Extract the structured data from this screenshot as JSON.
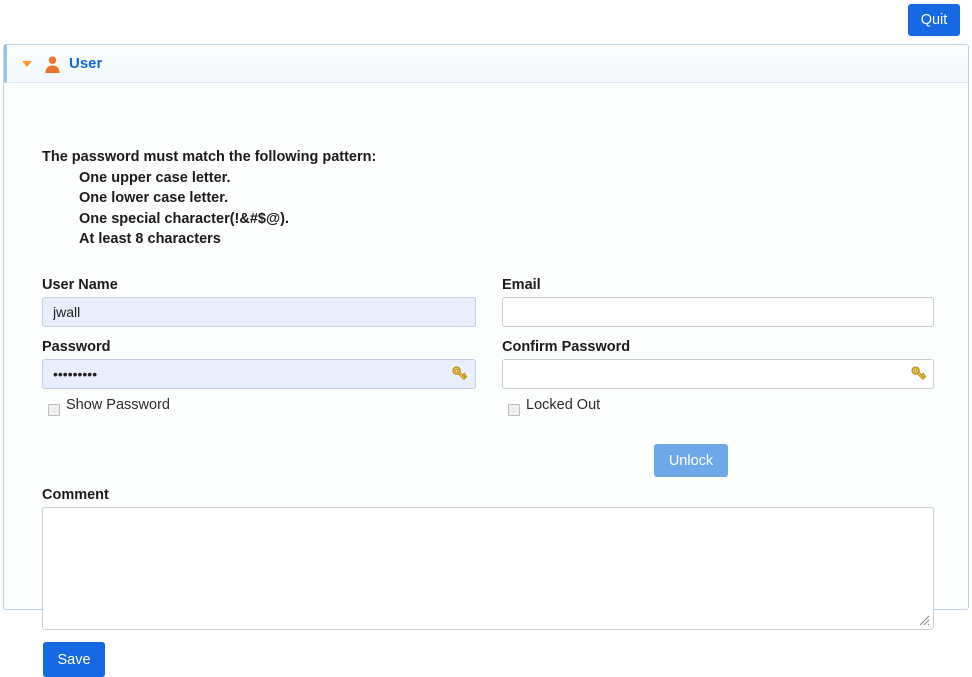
{
  "topbar": {
    "quit_label": "Quit"
  },
  "panel": {
    "title": "User",
    "collapse_icon": "caret-down-icon",
    "user_icon": "person-icon",
    "accent_color": "#1668d8",
    "icon_color": "#e8772e"
  },
  "password_rules": {
    "heading": "The password must match the following pattern:",
    "items": [
      "One upper case letter.",
      "One lower case letter.",
      "One special character(!&#$@).",
      "At least 8 characters"
    ]
  },
  "form": {
    "username": {
      "label": "User Name",
      "value": "jwall",
      "placeholder": ""
    },
    "email": {
      "label": "Email",
      "value": "",
      "placeholder": ""
    },
    "password": {
      "label": "Password",
      "value": "•••••••••",
      "placeholder": "",
      "icon": "key-icon"
    },
    "confirm_password": {
      "label": "Confirm Password",
      "value": "",
      "placeholder": "",
      "icon": "key-icon"
    },
    "show_password": {
      "label": "Show Password",
      "checked": false
    },
    "locked_out": {
      "label": "Locked Out",
      "checked": false
    },
    "unlock": {
      "label": "Unlock"
    },
    "comment": {
      "label": "Comment",
      "value": "",
      "placeholder": ""
    },
    "save": {
      "label": "Save"
    }
  },
  "colors": {
    "primary_button": "#1669e3",
    "disabled_button": "#6fa8e8",
    "autofill_field": "#e8eefb",
    "panel_border": "#bfd4e8"
  }
}
